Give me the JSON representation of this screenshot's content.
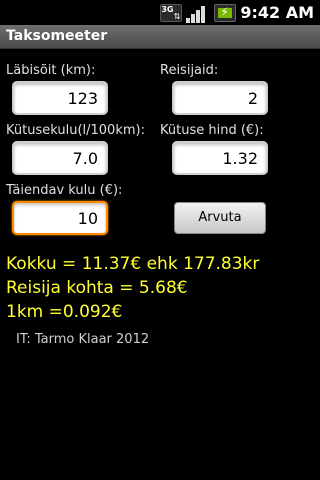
{
  "status": {
    "network": "3G",
    "time": "9:42 AM"
  },
  "title": "Taksomeeter",
  "fields": {
    "distance": {
      "label": "Läbisõit (km):",
      "value": "123"
    },
    "passengers": {
      "label": "Reisijaid:",
      "value": "2"
    },
    "consumption": {
      "label": "Kütusekulu(l/100km):",
      "value": "7.0"
    },
    "fuel_price": {
      "label": "Kütuse hind (€):",
      "value": "1.32"
    },
    "extra_cost": {
      "label": "Täiendav kulu (€):",
      "value": "10"
    }
  },
  "calculate_button": "Arvuta",
  "results": {
    "total": "Kokku = 11.37€ ehk 177.83kr",
    "per_passenger": "Reisija kohta = 5.68€",
    "per_km": "1km =0.092€"
  },
  "credit": "IT: Tarmo Klaar 2012",
  "icons": {
    "network": "3g-icon",
    "signal": "signal-strength-icon",
    "battery": "battery-charging-icon"
  },
  "colors": {
    "accent_focus": "#ff8a00",
    "result_text": "#ffff33",
    "background": "#000000"
  }
}
